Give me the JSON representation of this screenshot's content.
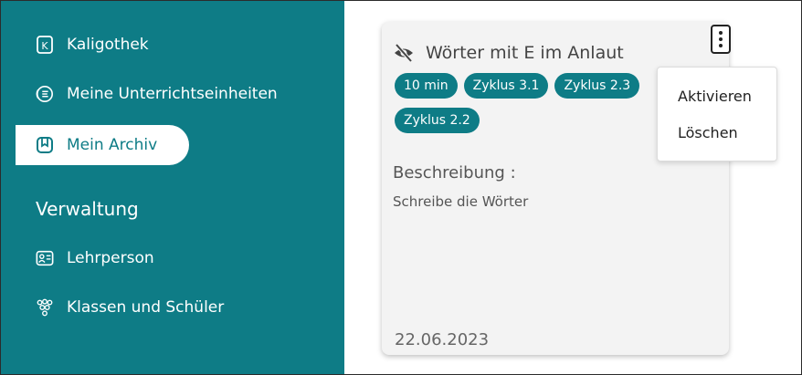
{
  "sidebar": {
    "items": [
      {
        "label": "Kaligothek",
        "icon": "k-book-icon"
      },
      {
        "label": "Meine Unterrichtseinheiten",
        "icon": "lesson-icon"
      },
      {
        "label": "Mein Archiv",
        "icon": "archive-icon",
        "active": true
      }
    ],
    "section_title": "Verwaltung",
    "admin_items": [
      {
        "label": "Lehrperson",
        "icon": "id-card-icon"
      },
      {
        "label": "Klassen und Schüler",
        "icon": "people-group-icon"
      }
    ]
  },
  "card": {
    "title": "Wörter mit E im Anlaut",
    "hidden_icon": "eye-slash-icon",
    "tags": [
      "10 min",
      "Zyklus 3.1",
      "Zyklus 2.3",
      "Zyklus 2.2"
    ],
    "description_label": "Beschreibung :",
    "description": "Schreibe die Wörter",
    "date": "22.06.2023"
  },
  "context_menu": {
    "items": [
      "Aktivieren",
      "Löschen"
    ]
  },
  "colors": {
    "accent": "#0e7c86",
    "card_bg": "#f3f3f3"
  }
}
